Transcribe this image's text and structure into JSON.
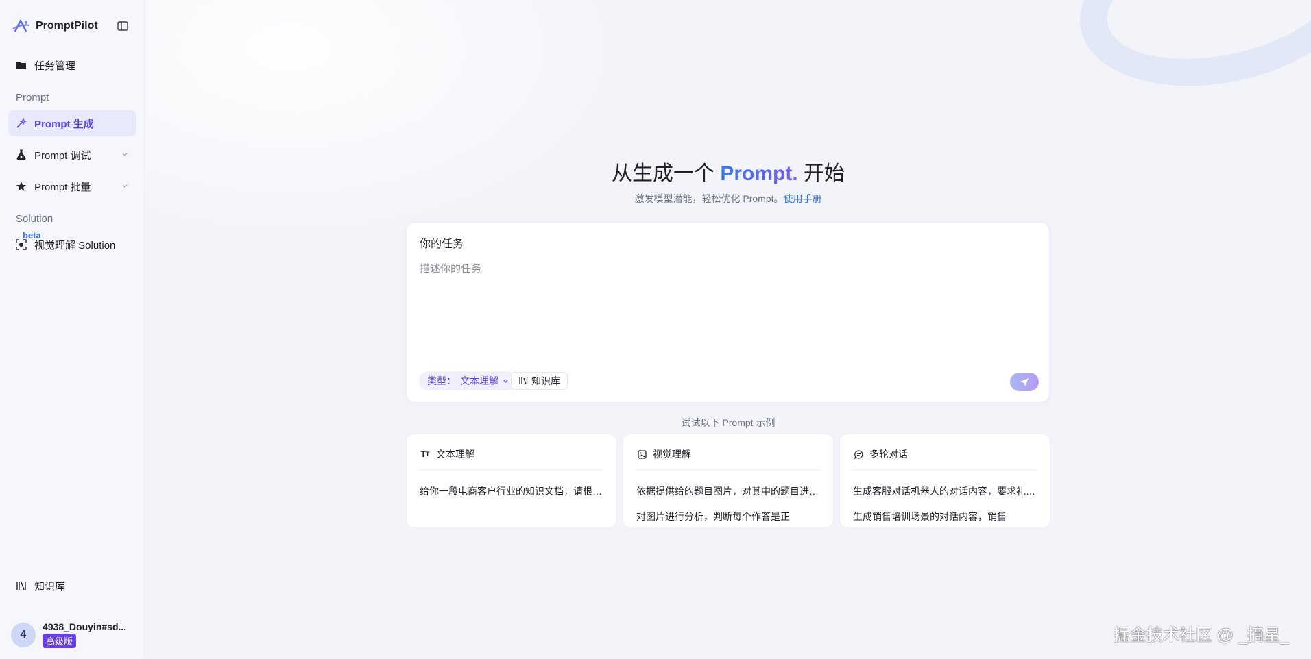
{
  "sidebar": {
    "brand": "PromptPilot",
    "items": [
      {
        "label": "任务管理"
      },
      {
        "label": "Prompt 生成"
      },
      {
        "label": "Prompt 调试"
      },
      {
        "label": "Prompt 批量"
      },
      {
        "label": "视觉理解 Solution"
      },
      {
        "label": "知识库"
      }
    ],
    "sections": {
      "prompt": "Prompt",
      "solution": "Solution"
    },
    "beta": "beta",
    "user": {
      "avatar": "4",
      "name": "4938_Douyin#sd...",
      "tier": "高级版"
    }
  },
  "hero": {
    "title_pre": "从生成一个 ",
    "title_accent": "Prompt.",
    "title_post": " 开始",
    "subtitle": "激发模型潜能，轻松优化 Prompt。",
    "manual_link": "使用手册"
  },
  "task": {
    "label": "你的任务",
    "placeholder": "描述你的任务",
    "type_label": "类型：",
    "type_value": "文本理解",
    "knowledge_button": "知识库"
  },
  "examples": {
    "title": "试试以下 Prompt 示例",
    "cards": [
      {
        "icon": "text-type-icon",
        "title": "文本理解",
        "line1": "给你一段电商客户行业的知识文档，请根据文档内容回答用户的问题",
        "line2": ""
      },
      {
        "icon": "image-icon",
        "title": "视觉理解",
        "line1": "依据提供给的题目图片，对其中的题目进行解答",
        "line2": "对图片进行分析，判断每个作答是正"
      },
      {
        "icon": "chat-icon",
        "title": "多轮对话",
        "line1": "生成客服对话机器人的对话内容，要求礼貌专业",
        "line2": "生成销售培训场景的对话内容，销售"
      }
    ]
  },
  "watermark": "掘金技术社区 @ _摘星_",
  "colors": {
    "accent": "#5b47e0",
    "link": "#3a6fe0",
    "tier": "#6a3fe8"
  }
}
